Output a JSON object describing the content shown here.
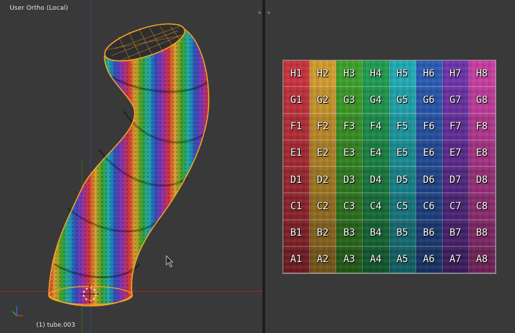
{
  "viewport": {
    "title": "User Ortho (Local)",
    "object_status": "(1) tube.003"
  },
  "uv_editor": {
    "columns": [
      "#c8323c",
      "#d29b2d",
      "#3ca028",
      "#1e9c50",
      "#1eaab4",
      "#285ab4",
      "#6e32aa",
      "#c83ca0"
    ],
    "rows": [
      [
        "H1",
        "H2",
        "H3",
        "H4",
        "H5",
        "H6",
        "H7",
        "H8"
      ],
      [
        "G1",
        "G2",
        "G3",
        "G4",
        "G5",
        "G6",
        "G7",
        "G8"
      ],
      [
        "F1",
        "F2",
        "F3",
        "F4",
        "F5",
        "F6",
        "F7",
        "F8"
      ],
      [
        "E1",
        "E2",
        "E3",
        "E4",
        "E5",
        "E6",
        "E7",
        "E8"
      ],
      [
        "D1",
        "D2",
        "D3",
        "D4",
        "D5",
        "D6",
        "D7",
        "D8"
      ],
      [
        "C1",
        "C2",
        "C3",
        "C4",
        "C5",
        "C6",
        "C7",
        "C8"
      ],
      [
        "B1",
        "B2",
        "B3",
        "B4",
        "B5",
        "B6",
        "B7",
        "B8"
      ],
      [
        "A1",
        "A2",
        "A3",
        "A4",
        "A5",
        "A6",
        "A7",
        "A8"
      ]
    ]
  }
}
